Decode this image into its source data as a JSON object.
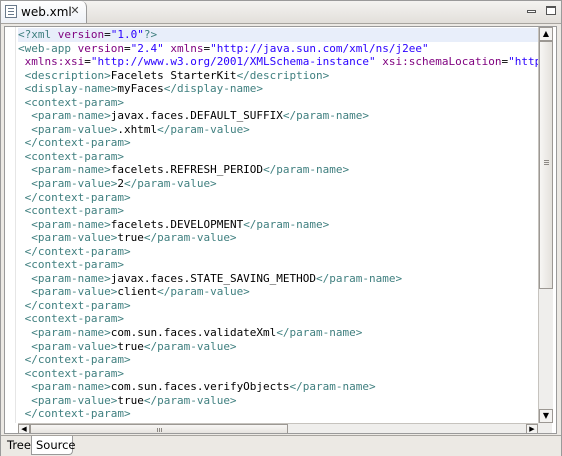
{
  "editor_tab": {
    "title": "web.xml",
    "file_icon": "xml-file-icon",
    "close_icon": "close-icon"
  },
  "window_controls": {
    "minimize_icon": "minimize-icon",
    "maximize_icon": "maximize-icon"
  },
  "colors": {
    "tag": "#3f7f7f",
    "attribute": "#7f007f",
    "value": "#2a00ff",
    "text": "#000000",
    "current_line": "#e8eefa"
  },
  "code_lines": [
    [
      [
        "pi",
        "<?"
      ],
      [
        "tag",
        "xml "
      ],
      [
        "attr",
        "version"
      ],
      [
        "text",
        "="
      ],
      [
        "val",
        "\"1.0\""
      ],
      [
        "pi",
        "?>"
      ]
    ],
    [
      [
        "tag",
        "<web-app "
      ],
      [
        "attr",
        "version"
      ],
      [
        "text",
        "="
      ],
      [
        "val",
        "\"2.4\""
      ],
      [
        "text",
        " "
      ],
      [
        "attr",
        "xmlns"
      ],
      [
        "text",
        "="
      ],
      [
        "val",
        "\"http://java.sun.com/xml/ns/j2ee\""
      ]
    ],
    [
      [
        "text",
        " "
      ],
      [
        "attr",
        "xmlns:xsi"
      ],
      [
        "text",
        "="
      ],
      [
        "val",
        "\"http://www.w3.org/2001/XMLSchema-instance\""
      ],
      [
        "text",
        " "
      ],
      [
        "attr",
        "xsi:schemaLocation"
      ],
      [
        "text",
        "="
      ],
      [
        "val",
        "\"http:/"
      ]
    ],
    [
      [
        "text",
        " "
      ],
      [
        "tag",
        "<description>"
      ],
      [
        "text",
        "Facelets StarterKit"
      ],
      [
        "tag",
        "</description>"
      ]
    ],
    [
      [
        "text",
        " "
      ],
      [
        "tag",
        "<display-name>"
      ],
      [
        "text",
        "myFaces"
      ],
      [
        "tag",
        "</display-name>"
      ]
    ],
    [
      [
        "text",
        " "
      ],
      [
        "tag",
        "<context-param>"
      ]
    ],
    [
      [
        "text",
        "  "
      ],
      [
        "tag",
        "<param-name>"
      ],
      [
        "text",
        "javax.faces.DEFAULT_SUFFIX"
      ],
      [
        "tag",
        "</param-name>"
      ]
    ],
    [
      [
        "text",
        "  "
      ],
      [
        "tag",
        "<param-value>"
      ],
      [
        "text",
        ".xhtml"
      ],
      [
        "tag",
        "</param-value>"
      ]
    ],
    [
      [
        "text",
        " "
      ],
      [
        "tag",
        "</context-param>"
      ]
    ],
    [
      [
        "text",
        " "
      ],
      [
        "tag",
        "<context-param>"
      ]
    ],
    [
      [
        "text",
        "  "
      ],
      [
        "tag",
        "<param-name>"
      ],
      [
        "text",
        "facelets.REFRESH_PERIOD"
      ],
      [
        "tag",
        "</param-name>"
      ]
    ],
    [
      [
        "text",
        "  "
      ],
      [
        "tag",
        "<param-value>"
      ],
      [
        "text",
        "2"
      ],
      [
        "tag",
        "</param-value>"
      ]
    ],
    [
      [
        "text",
        " "
      ],
      [
        "tag",
        "</context-param>"
      ]
    ],
    [
      [
        "text",
        " "
      ],
      [
        "tag",
        "<context-param>"
      ]
    ],
    [
      [
        "text",
        "  "
      ],
      [
        "tag",
        "<param-name>"
      ],
      [
        "text",
        "facelets.DEVELOPMENT"
      ],
      [
        "tag",
        "</param-name>"
      ]
    ],
    [
      [
        "text",
        "  "
      ],
      [
        "tag",
        "<param-value>"
      ],
      [
        "text",
        "true"
      ],
      [
        "tag",
        "</param-value>"
      ]
    ],
    [
      [
        "text",
        " "
      ],
      [
        "tag",
        "</context-param>"
      ]
    ],
    [
      [
        "text",
        " "
      ],
      [
        "tag",
        "<context-param>"
      ]
    ],
    [
      [
        "text",
        "  "
      ],
      [
        "tag",
        "<param-name>"
      ],
      [
        "text",
        "javax.faces.STATE_SAVING_METHOD"
      ],
      [
        "tag",
        "</param-name>"
      ]
    ],
    [
      [
        "text",
        "  "
      ],
      [
        "tag",
        "<param-value>"
      ],
      [
        "text",
        "client"
      ],
      [
        "tag",
        "</param-value>"
      ]
    ],
    [
      [
        "text",
        " "
      ],
      [
        "tag",
        "</context-param>"
      ]
    ],
    [
      [
        "text",
        " "
      ],
      [
        "tag",
        "<context-param>"
      ]
    ],
    [
      [
        "text",
        "  "
      ],
      [
        "tag",
        "<param-name>"
      ],
      [
        "text",
        "com.sun.faces.validateXml"
      ],
      [
        "tag",
        "</param-name>"
      ]
    ],
    [
      [
        "text",
        "  "
      ],
      [
        "tag",
        "<param-value>"
      ],
      [
        "text",
        "true"
      ],
      [
        "tag",
        "</param-value>"
      ]
    ],
    [
      [
        "text",
        " "
      ],
      [
        "tag",
        "</context-param>"
      ]
    ],
    [
      [
        "text",
        " "
      ],
      [
        "tag",
        "<context-param>"
      ]
    ],
    [
      [
        "text",
        "  "
      ],
      [
        "tag",
        "<param-name>"
      ],
      [
        "text",
        "com.sun.faces.verifyObjects"
      ],
      [
        "tag",
        "</param-name>"
      ]
    ],
    [
      [
        "text",
        "  "
      ],
      [
        "tag",
        "<param-value>"
      ],
      [
        "text",
        "true"
      ],
      [
        "tag",
        "</param-value>"
      ]
    ],
    [
      [
        "text",
        " "
      ],
      [
        "tag",
        "</context-param>"
      ]
    ]
  ],
  "current_line_index": 0,
  "scrollbars": {
    "up_icon": "arrow-up-icon",
    "down_icon": "arrow-down-icon",
    "left_icon": "arrow-left-icon",
    "right_icon": "arrow-right-icon"
  },
  "bottom_tabs": {
    "tree": "Tree",
    "source": "Source",
    "active": "Source"
  }
}
